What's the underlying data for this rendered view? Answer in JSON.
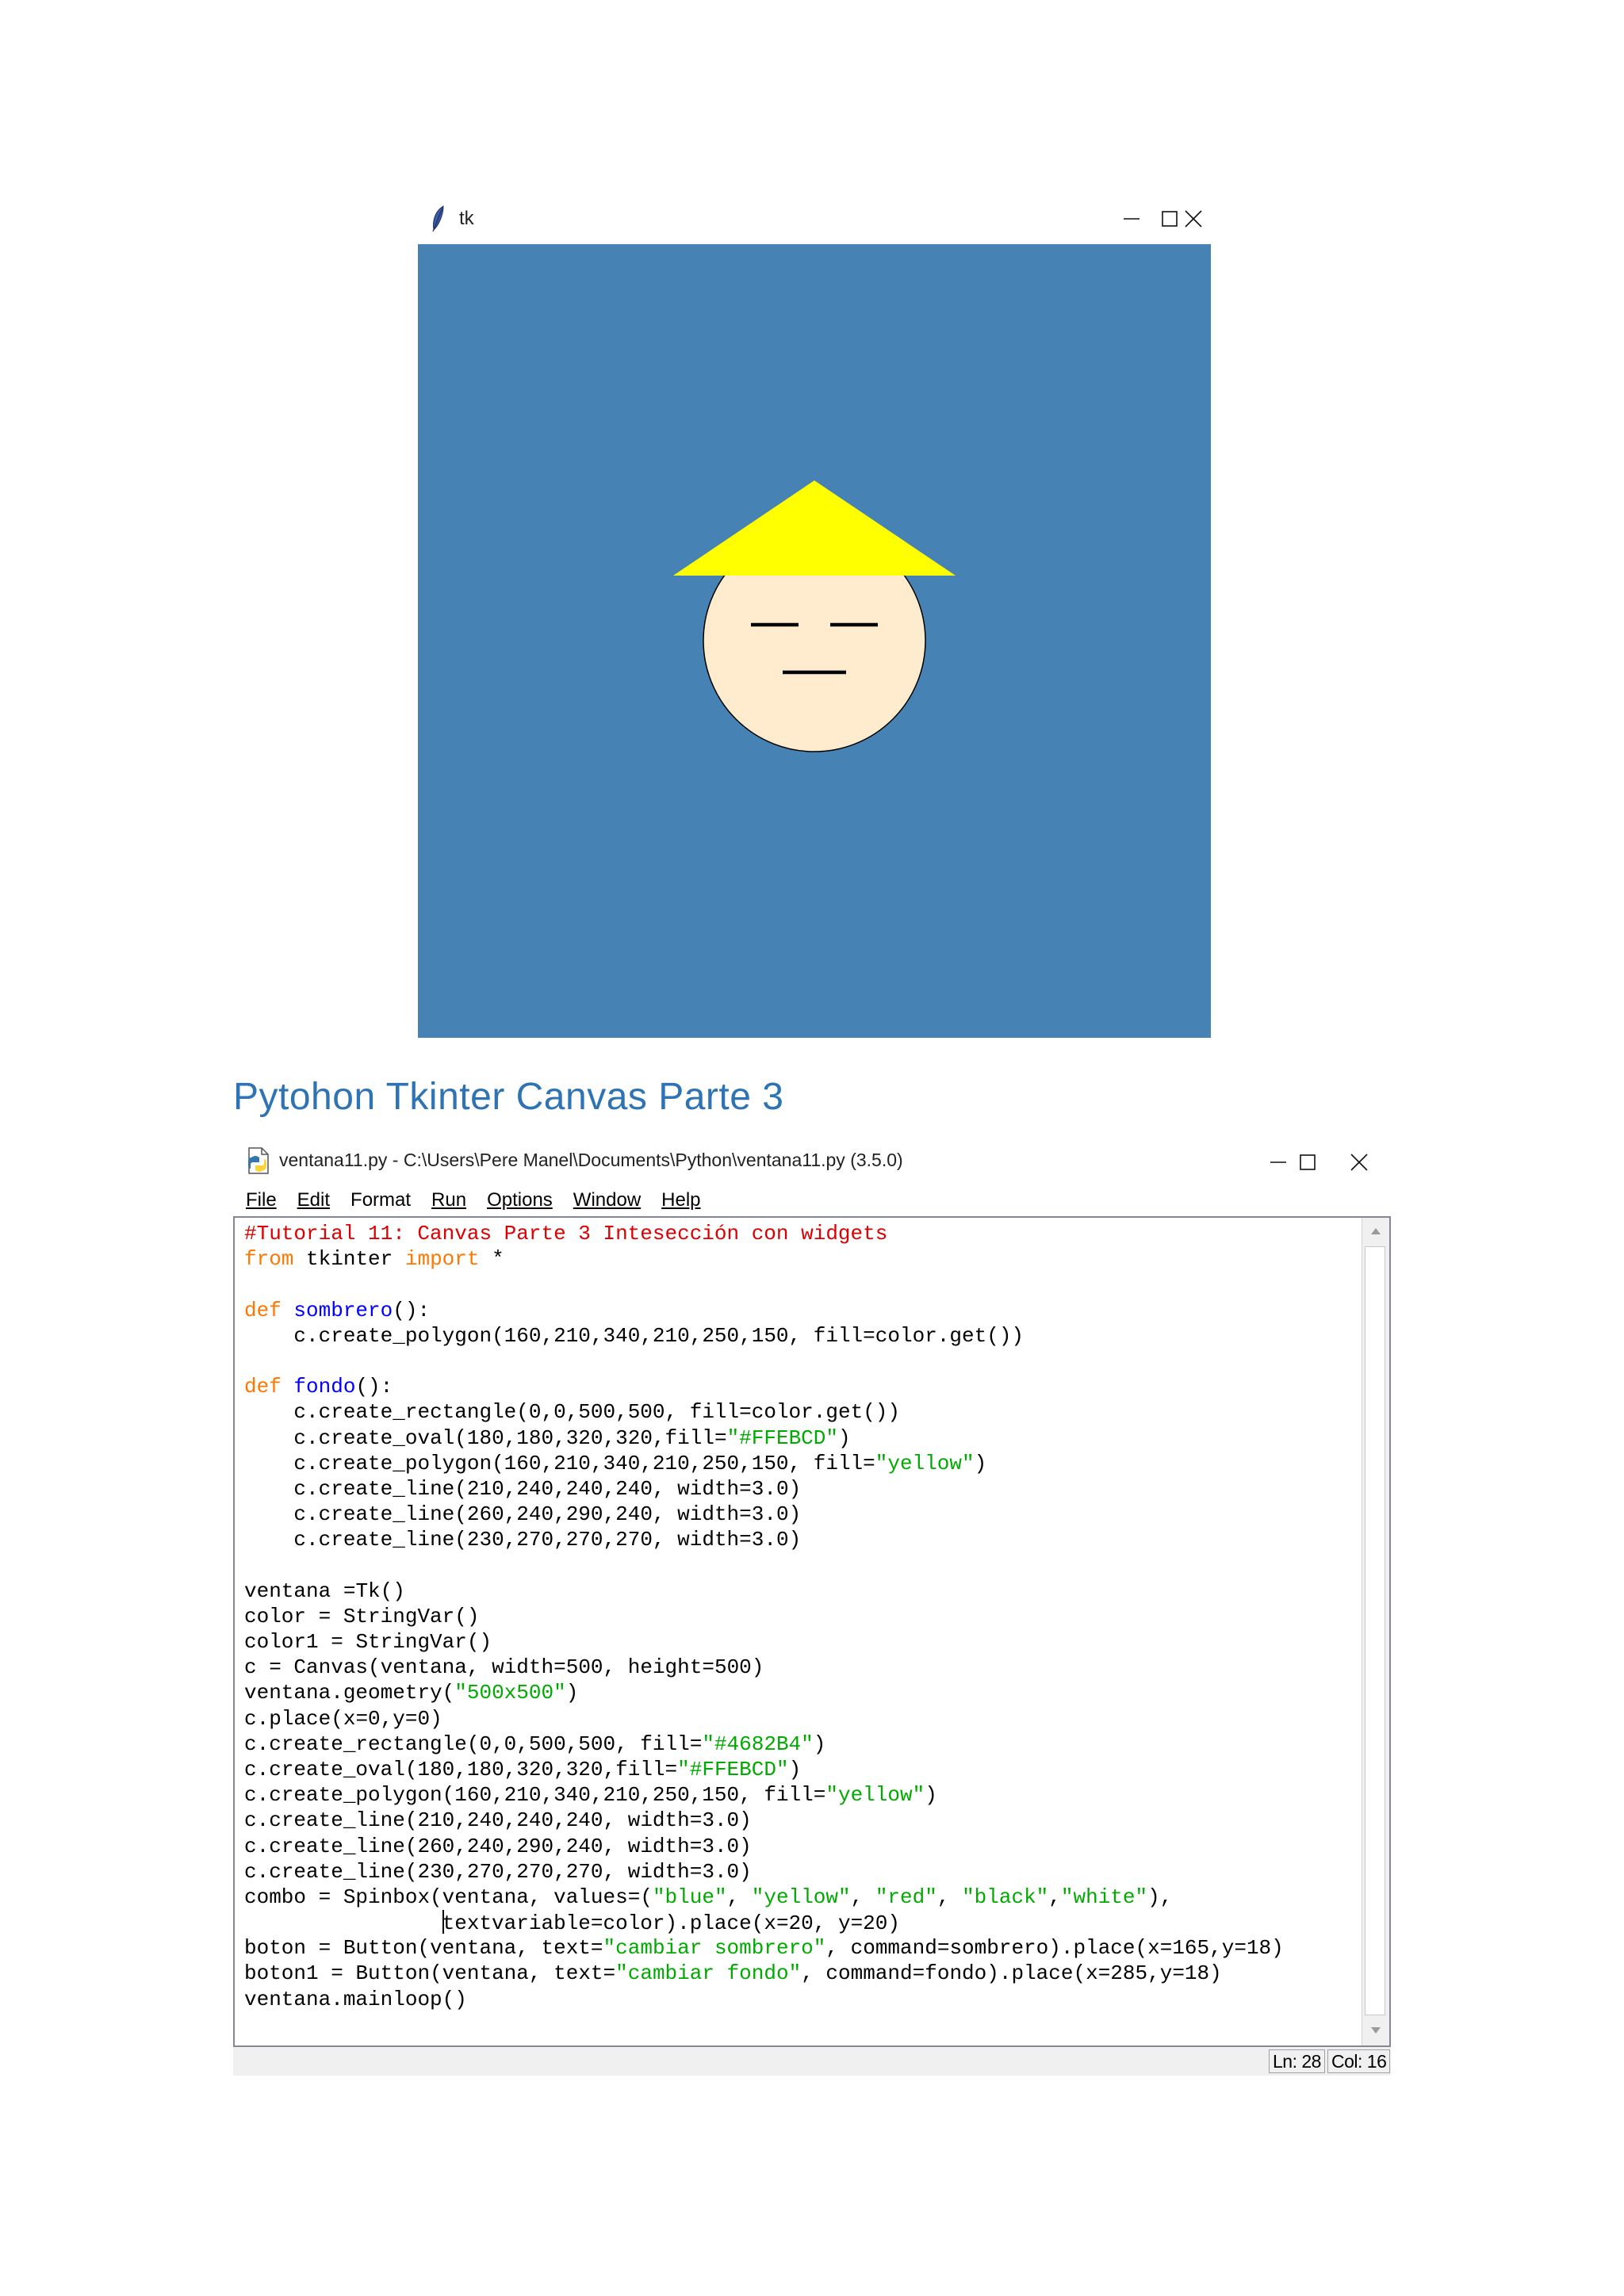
{
  "tk_window": {
    "title": "tk",
    "canvas": {
      "background": "#4682B4",
      "face_fill": "#FFEBCD",
      "hat_fill": "yellow"
    }
  },
  "heading": "Pytohon Tkinter Canvas Parte 3",
  "idle_window": {
    "title": "ventana11.py - C:\\Users\\Pere Manel\\Documents\\Python\\ventana11.py (3.5.0)",
    "menu": [
      "File",
      "Edit",
      "Format",
      "Run",
      "Options",
      "Window",
      "Help"
    ],
    "code_lines": [
      "#Tutorial 11: Canvas Parte 3 Intesección con widgets",
      "from tkinter import *",
      "",
      "def sombrero():",
      "    c.create_polygon(160,210,340,210,250,150, fill=color.get())",
      "",
      "def fondo():",
      "    c.create_rectangle(0,0,500,500, fill=color.get())",
      "    c.create_oval(180,180,320,320,fill=\"#FFEBCD\")",
      "    c.create_polygon(160,210,340,210,250,150, fill=\"yellow\")",
      "    c.create_line(210,240,240,240, width=3.0)",
      "    c.create_line(260,240,290,240, width=3.0)",
      "    c.create_line(230,270,270,270, width=3.0)",
      "",
      "ventana =Tk()",
      "color = StringVar()",
      "color1 = StringVar()",
      "c = Canvas(ventana, width=500, height=500)",
      "ventana.geometry(\"500x500\")",
      "c.place(x=0,y=0)",
      "c.create_rectangle(0,0,500,500, fill=\"#4682B4\")",
      "c.create_oval(180,180,320,320,fill=\"#FFEBCD\")",
      "c.create_polygon(160,210,340,210,250,150, fill=\"yellow\")",
      "c.create_line(210,240,240,240, width=3.0)",
      "c.create_line(260,240,290,240, width=3.0)",
      "c.create_line(230,270,270,270, width=3.0)",
      "combo = Spinbox(ventana, values=(\"blue\", \"yellow\", \"red\", \"black\",\"white\"),",
      "                textvariable=color).place(x=20, y=20)",
      "boton = Button(ventana, text=\"cambiar sombrero\", command=sombrero).place(x=165,y=18)",
      "boton1 = Button(ventana, text=\"cambiar fondo\", command=fondo).place(x=285,y=18)",
      "ventana.mainloop()"
    ],
    "status": {
      "line": "Ln: 28",
      "col": "Col: 16"
    }
  },
  "icons": {
    "tk_window": "tk-feather-icon",
    "idle_window": "python-file-icon",
    "minimize": "minimize-icon",
    "maximize": "maximize-icon",
    "close": "close-icon",
    "scroll_up": "scroll-up-arrow-icon",
    "scroll_down": "scroll-down-arrow-icon"
  }
}
